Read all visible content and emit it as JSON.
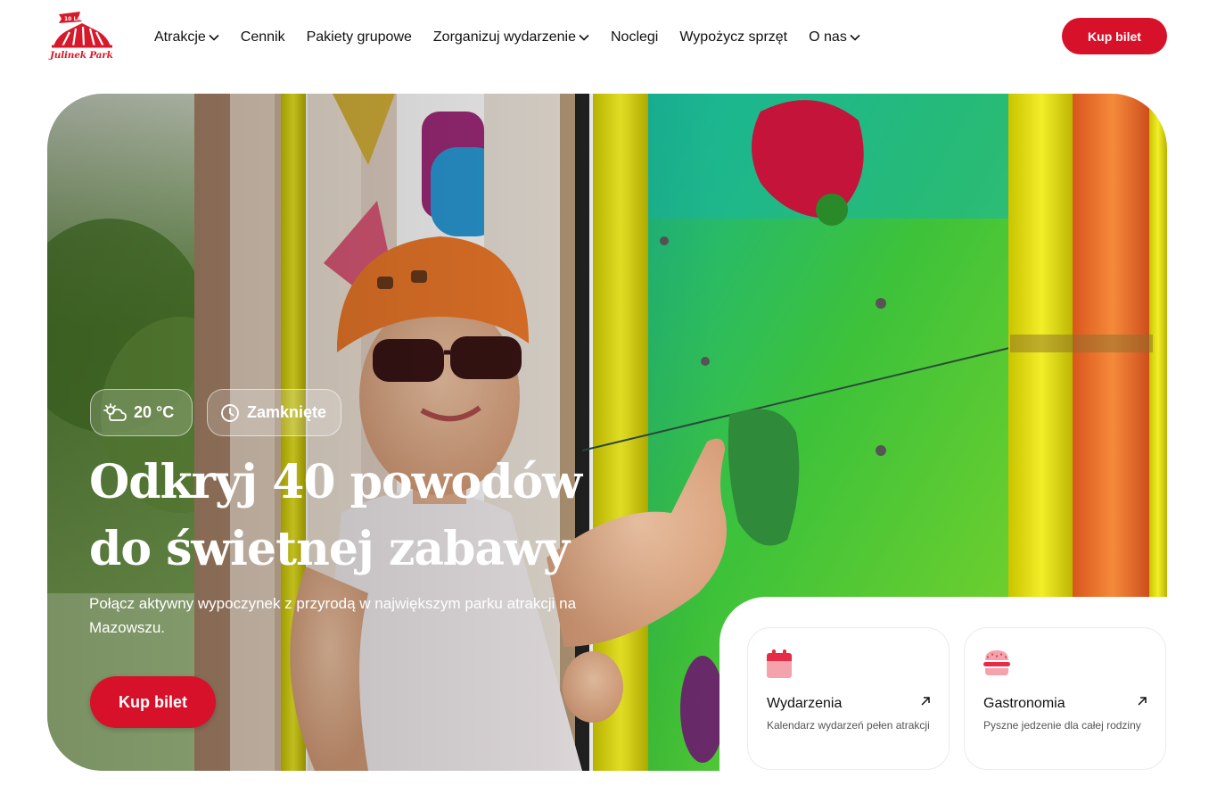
{
  "brand": {
    "logo_badge": "10 LAT",
    "logo_text": "Julinek Park",
    "accent_color": "#d7112a"
  },
  "nav": {
    "items": [
      {
        "label": "Atrakcje",
        "has_dropdown": true
      },
      {
        "label": "Cennik",
        "has_dropdown": false
      },
      {
        "label": "Pakiety grupowe",
        "has_dropdown": false
      },
      {
        "label": "Zorganizuj wydarzenie",
        "has_dropdown": true
      },
      {
        "label": "Noclegi",
        "has_dropdown": false
      },
      {
        "label": "Wypożycz sprzęt",
        "has_dropdown": false
      },
      {
        "label": "O nas",
        "has_dropdown": true
      }
    ],
    "cta_label": "Kup bilet"
  },
  "hero": {
    "weather": {
      "icon": "cloud-sun-icon",
      "value": "20 °C"
    },
    "hours": {
      "icon": "clock-icon",
      "status": "Zamknięte"
    },
    "title_line1": "Odkryj 40 powodów",
    "title_line2": "do świetnej zabawy",
    "subtitle": "Połącz aktywny wypoczynek z przyrodą w największym parku atrakcji na Mazowszu.",
    "cta_label": "Kup bilet"
  },
  "cards": [
    {
      "icon": "calendar-icon",
      "title": "Wydarzenia",
      "description": "Kalendarz wydarzeń pełen atrakcji",
      "arrow": "arrow-up-right-icon"
    },
    {
      "icon": "burger-icon",
      "title": "Gastronomia",
      "description": "Pyszne jedzenie dla całej rodziny",
      "arrow": "arrow-up-right-icon"
    }
  ]
}
